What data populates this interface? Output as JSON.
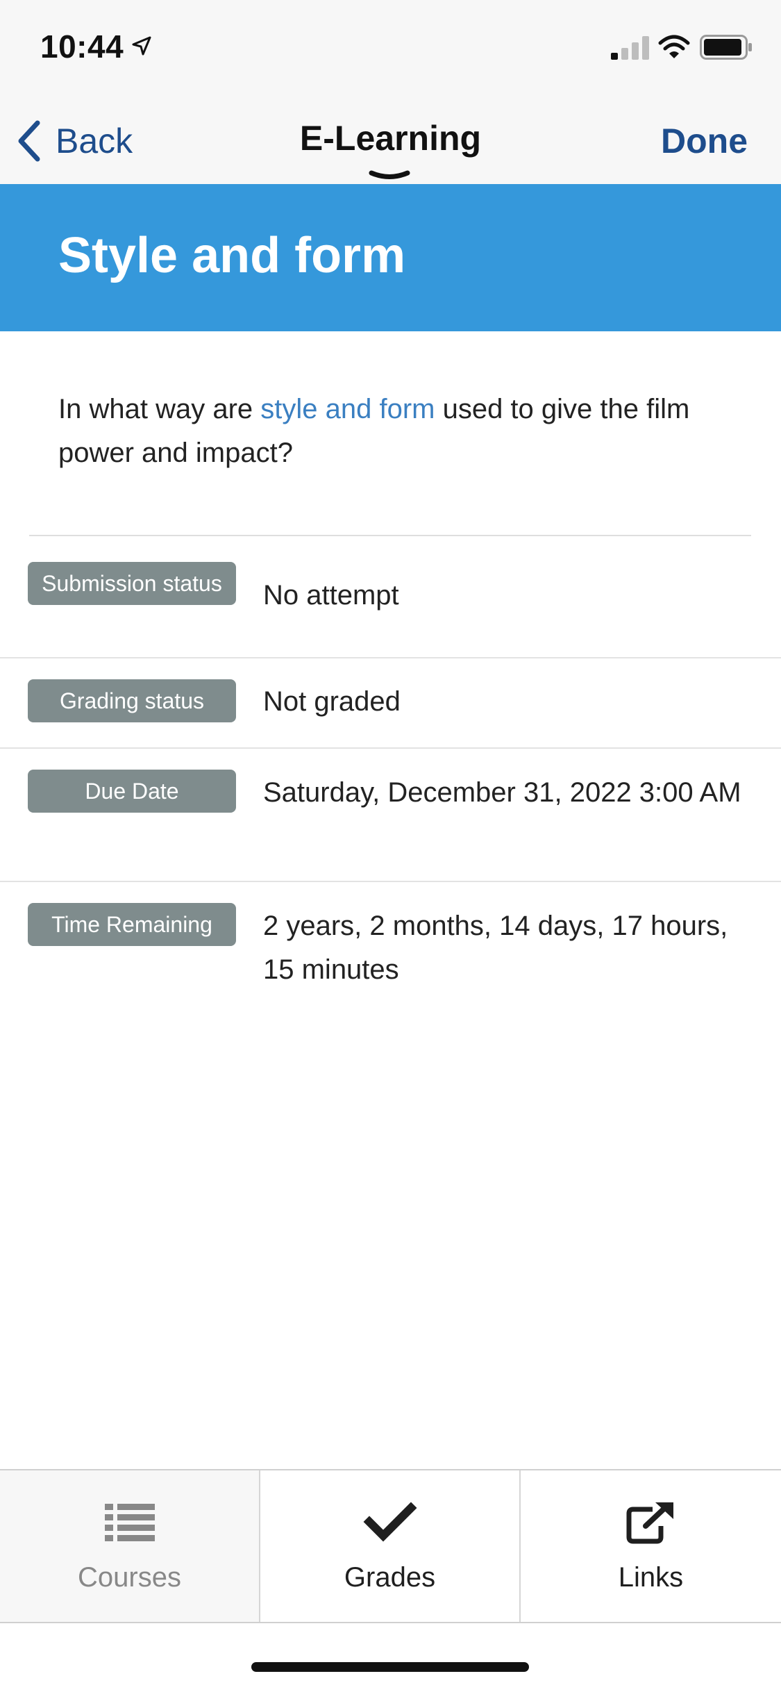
{
  "status_bar": {
    "time": "10:44"
  },
  "nav": {
    "back_label": "Back",
    "title": "E-Learning",
    "done_label": "Done"
  },
  "header": {
    "title": "Style and form"
  },
  "description": {
    "prefix": "In what way are ",
    "link_text": "style and form",
    "suffix": " used to give the film power and impact?"
  },
  "rows": [
    {
      "label": "Submission status",
      "value": "No attempt"
    },
    {
      "label": "Grading status",
      "value": "Not graded"
    },
    {
      "label": "Due Date",
      "value": "Saturday, December 31, 2022 3:00 AM"
    },
    {
      "label": "Time Remaining",
      "value": "2 years, 2 months, 14 days, 17 hours, 15 minutes"
    }
  ],
  "tabs": [
    {
      "label": "Courses",
      "icon": "list-icon",
      "active": false
    },
    {
      "label": "Grades",
      "icon": "checkmark-icon",
      "active": true
    },
    {
      "label": "Links",
      "icon": "external-link-icon",
      "active": false
    }
  ],
  "colors": {
    "header_bg": "#3598db",
    "nav_accent": "#1e4d8c",
    "link": "#3a7fc1",
    "badge_bg": "#7f8c8d"
  }
}
